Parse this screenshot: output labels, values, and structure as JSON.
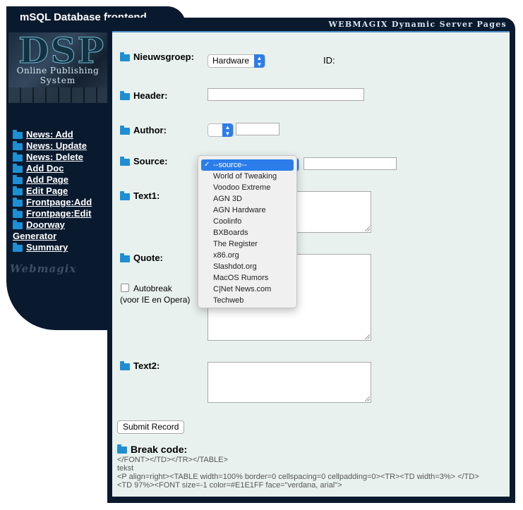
{
  "header": {
    "app_title": "mSQL Database frontend",
    "tagline": "WEBMAGIX Dynamic Server Pages"
  },
  "logo": {
    "mark": "DSP",
    "line1": "Online Publishing",
    "line2": "System"
  },
  "sidebar": {
    "items": [
      {
        "label": "News: Add"
      },
      {
        "label": "News: Update"
      },
      {
        "label": "News: Delete"
      },
      {
        "label": "Add Doc"
      },
      {
        "label": "Add Page"
      },
      {
        "label": "Edit Page"
      },
      {
        "label": "Frontpage:Add"
      },
      {
        "label": "Frontpage:Edit"
      },
      {
        "label": "Doorway"
      },
      {
        "label": "Generator"
      },
      {
        "label": "Summary"
      }
    ],
    "brand": "Webmagix"
  },
  "form": {
    "nieuwsgroep_label": "Nieuwsgroep:",
    "nieuwsgroep_value": "Hardware",
    "id_label": "ID:",
    "header_label": "Header:",
    "header_value": "",
    "author_label": "Author:",
    "author_select_value": "",
    "author_value": "",
    "source_label": "Source:",
    "source_value": "",
    "text1_label": "Text1:",
    "text1_value": "",
    "quote_label": "Quote:",
    "quote_value": "",
    "autobreak_label": "Autobreak",
    "autobreak_note": "(voor IE en Opera)",
    "autobreak_checked": false,
    "text2_label": "Text2:",
    "text2_value": "",
    "submit_label": "Submit Record"
  },
  "source_dropdown": {
    "selected_index": 0,
    "options": [
      "--source--",
      "World of Tweaking",
      "Voodoo Extreme",
      "AGN 3D",
      "AGN Hardware",
      "Coolinfo",
      "BXBoards",
      "The Register",
      "x86.org",
      "Slashdot.org",
      "MacOS Rumors",
      "C|Net News.com",
      "Techweb"
    ]
  },
  "break_code": {
    "title": "Break code:",
    "line1": "</FONT></TD></TR></TABLE>",
    "line2": "tekst",
    "line3": "<P align=right><TABLE width=100% border=0 cellspacing=0 cellpadding=0><TR><TD width=3%> </TD>",
    "line4": "<TD 97%><FONT size=-1 color=#E1E1FF face=\"verdana, arial\">"
  },
  "colors": {
    "frame": "#0a1a2e",
    "panel": "#e9f1ef",
    "accent": "#2b7de9",
    "folder": "#1e8fd4"
  }
}
